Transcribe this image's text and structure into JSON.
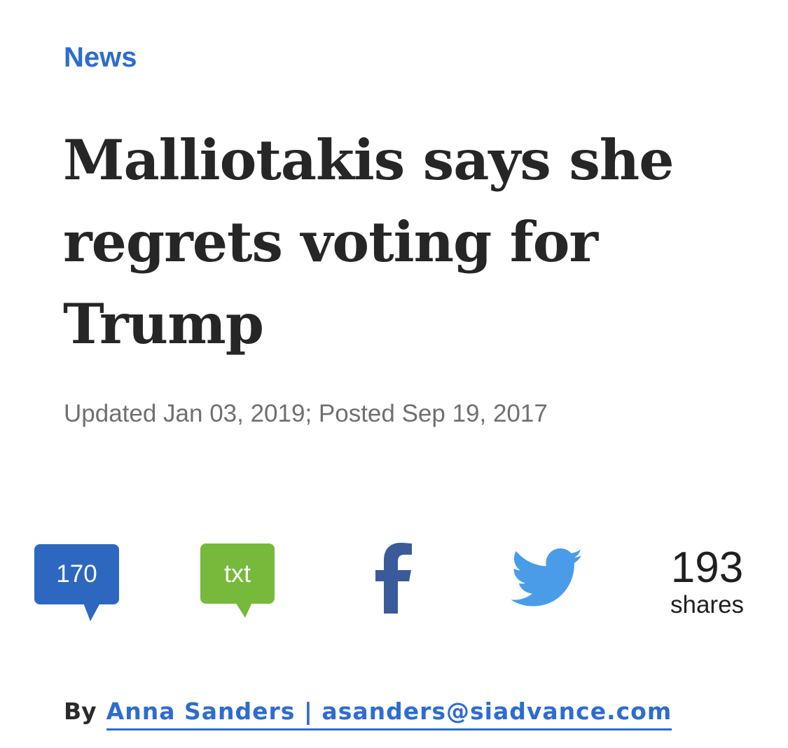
{
  "article": {
    "section": "News",
    "headline": "Malliotakis says she regrets voting for Trump",
    "dateline": "Updated Jan 03, 2019; Posted Sep 19, 2017"
  },
  "share_bar": {
    "comments_count": "170",
    "text_label": "txt",
    "facebook_icon": "facebook-icon",
    "twitter_icon": "twitter-icon",
    "share_count": "193",
    "share_label": "shares",
    "colors": {
      "comments": "#2e67c0",
      "text": "#77b93a",
      "facebook": "#3b5a9a",
      "twitter": "#4a9ce9"
    }
  },
  "byline": {
    "prefix": "By",
    "author": "Anna Sanders | asanders@siadvance.com"
  },
  "colors": {
    "accent": "#2e6ccf",
    "headline": "#262626",
    "meta": "#6f6f6f"
  }
}
